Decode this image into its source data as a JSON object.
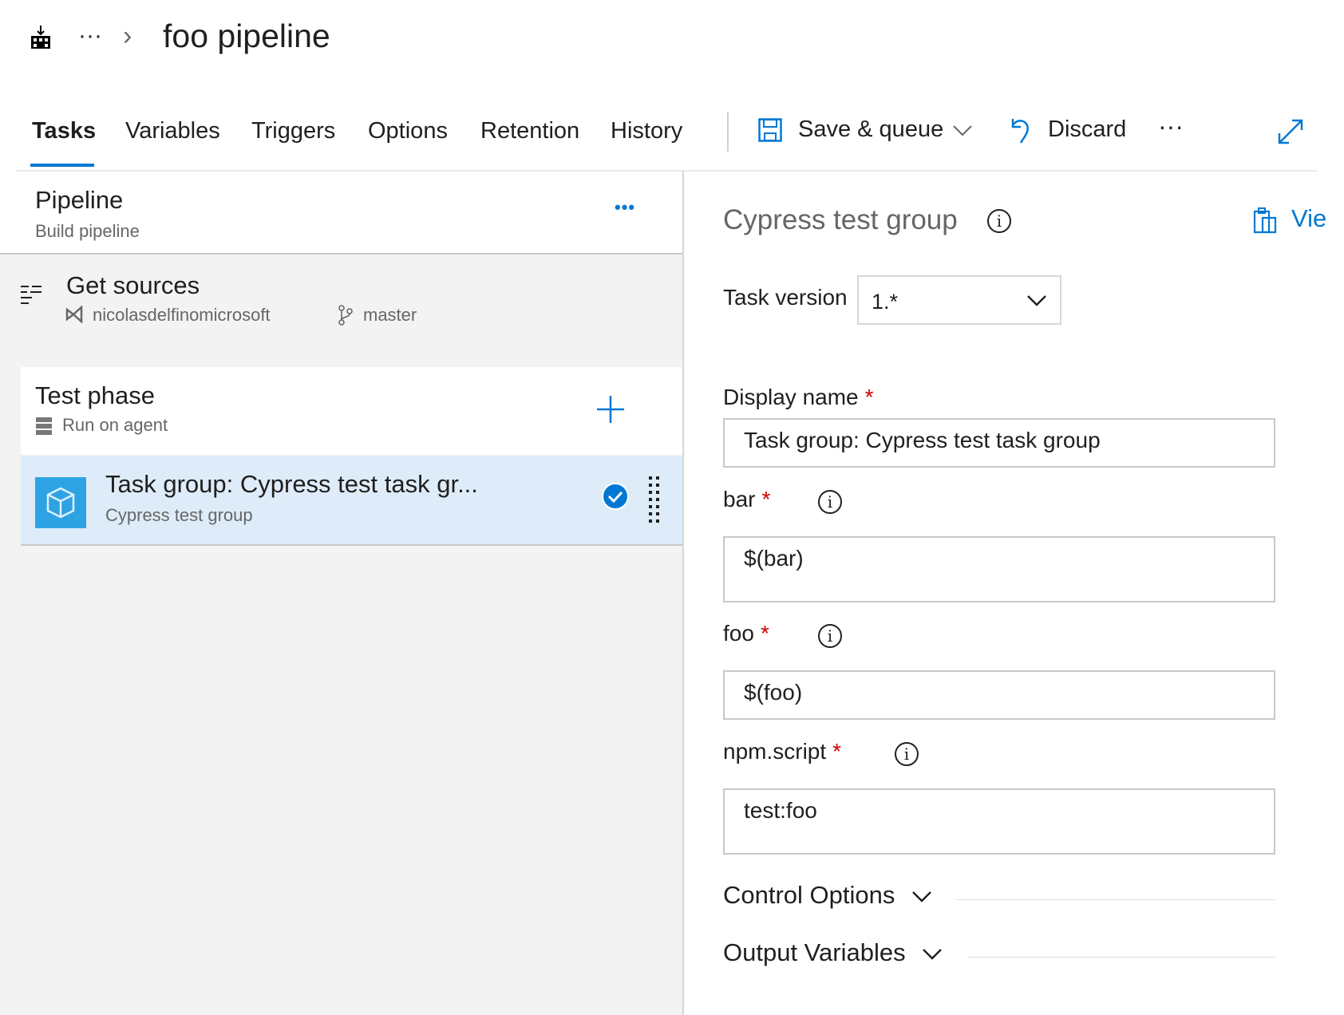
{
  "header": {
    "title": "foo pipeline",
    "breadcrumb_more": "···",
    "chevron": "›"
  },
  "tabs": [
    {
      "label": "Tasks",
      "active": true
    },
    {
      "label": "Variables"
    },
    {
      "label": "Triggers"
    },
    {
      "label": "Options"
    },
    {
      "label": "Retention"
    },
    {
      "label": "History"
    }
  ],
  "toolbar": {
    "save_label": "Save & queue",
    "discard_label": "Discard",
    "more": "···"
  },
  "pipeline": {
    "title": "Pipeline",
    "subtitle": "Build pipeline",
    "more": "•••"
  },
  "sources": {
    "title": "Get sources",
    "repo": "nicolasdelfinomicrosoft",
    "branch": "master"
  },
  "phase": {
    "title": "Test phase",
    "subtitle": "Run on agent",
    "add": "+"
  },
  "task": {
    "title": "Task group: Cypress test task gr...",
    "subtitle": "Cypress test group",
    "selected": true
  },
  "details": {
    "title": "Cypress test group",
    "view_label": "Vie",
    "task_version_label": "Task version",
    "task_version_value": "1.*",
    "fields": [
      {
        "label": "Display name",
        "required": "*",
        "value": "Task group: Cypress test task group"
      },
      {
        "label": "bar",
        "required": "*",
        "value": "$(bar)"
      },
      {
        "label": "foo",
        "required": "*",
        "value": "$(foo)"
      },
      {
        "label": "npm.script",
        "required": "*",
        "value": "test:foo"
      }
    ],
    "sections": [
      {
        "label": "Control Options"
      },
      {
        "label": "Output Variables"
      }
    ]
  },
  "colors": {
    "accent": "#0078d4",
    "selected_row": "#deecf9",
    "panel_bg": "#f3f3f3",
    "required": "#cc0000"
  }
}
